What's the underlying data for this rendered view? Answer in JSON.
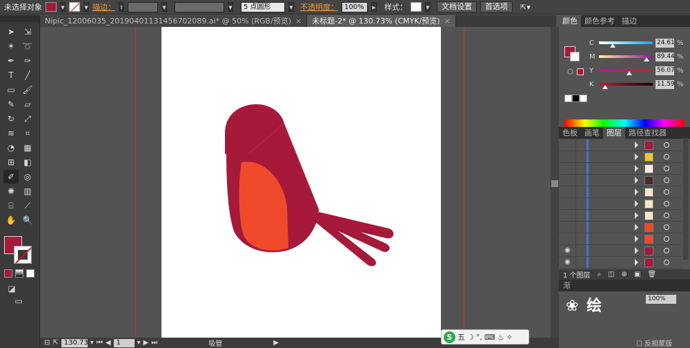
{
  "control_bar": {
    "no_selection": "未选择对象",
    "stroke_label": "描边：",
    "brush_value": "5 点圆形",
    "opacity_label": "不透明度：",
    "opacity_value": "100%",
    "style_label": "样式：",
    "doc_setup_button": "文档设置",
    "prefs_button": "首选项"
  },
  "doc_tabs": [
    {
      "label": "Nipic_12006035_20190401131456702089.ai* @ 50% (RGB/预览)",
      "close": "×"
    },
    {
      "label": "未标题-2* @ 130.73% (CMYK/预览)",
      "close": "×"
    }
  ],
  "colors": {
    "fill": "#a6193a",
    "tail": "#a6193a",
    "wing": "#ef4a2c",
    "guide": "#c7313a"
  },
  "color_panel": {
    "tabs": [
      "颜色",
      "颜色参考",
      "描边"
    ],
    "channels": [
      {
        "name": "C",
        "value": "24.61",
        "unit": "%",
        "pos": 0.25,
        "gradient": "linear-gradient(to right,#fff,#00aeef)"
      },
      {
        "name": "M",
        "value": "89.44",
        "unit": "%",
        "pos": 0.89,
        "gradient": "linear-gradient(to right,#ffe9a8,#8c1d8e)"
      },
      {
        "name": "Y",
        "value": "56.07",
        "unit": "%",
        "pos": 0.56,
        "gradient": "linear-gradient(to right,#c0159a,#d41a2a)"
      },
      {
        "name": "K",
        "value": "11.59",
        "unit": "%",
        "pos": 0.12,
        "gradient": "linear-gradient(to right,#c41a3a,#1a0000)"
      }
    ]
  },
  "layers_panel": {
    "tabs": [
      "色板",
      "画笔",
      "图层",
      "路径查找器"
    ],
    "footer": "1 个图层",
    "items": [
      {
        "thumb": "#a6193a",
        "eye": false
      },
      {
        "thumb": "#f3c62e",
        "eye": false
      },
      {
        "thumb": "#f5f0dc",
        "eye": false
      },
      {
        "thumb": "#4a2a2a",
        "eye": false
      },
      {
        "thumb": "#f5e6c8",
        "eye": false
      },
      {
        "thumb": "#f5e6c8",
        "eye": false
      },
      {
        "thumb": "#f5e6c8",
        "eye": false
      },
      {
        "thumb": "#ef4a2c",
        "eye": false
      },
      {
        "thumb": "#ef4a2c",
        "eye": false
      },
      {
        "thumb": "#a6193a",
        "eye": true
      },
      {
        "thumb": "#a6193a",
        "eye": true
      }
    ]
  },
  "transparency_panel": {
    "tab": "渐",
    "opacity": "100%",
    "invert_mask": "反相蒙版"
  },
  "status_bar": {
    "zoom": "130.73",
    "page": "1",
    "tool_name": "吸管"
  },
  "ime": {
    "label": "五",
    "s": "S"
  }
}
